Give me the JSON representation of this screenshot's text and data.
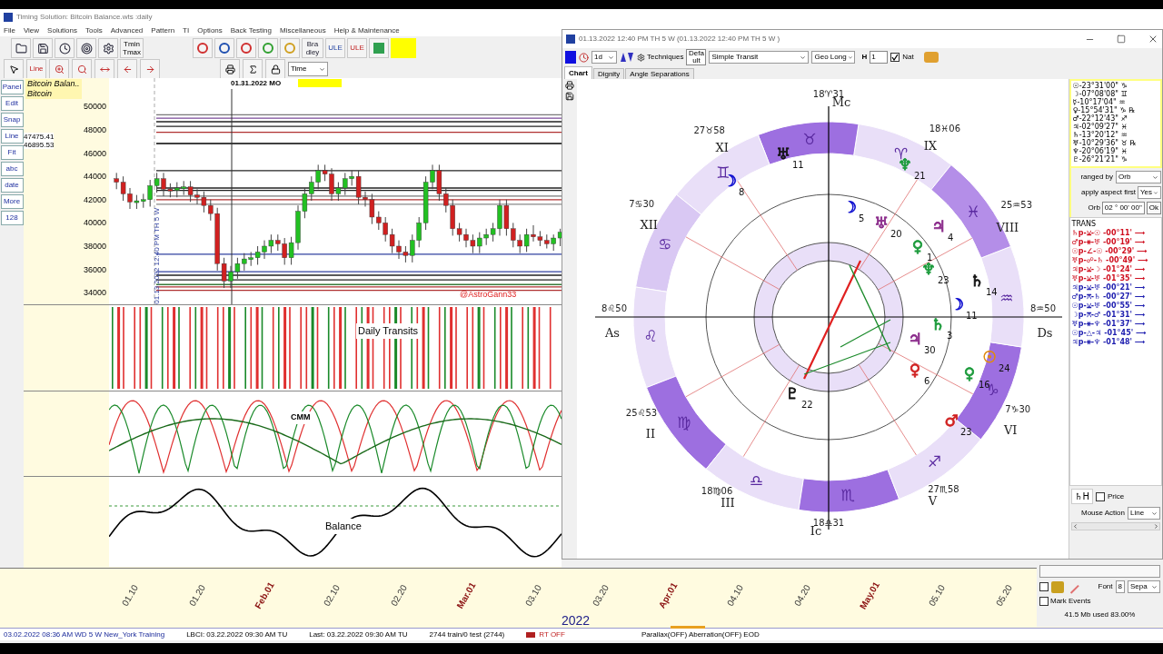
{
  "main_window": {
    "title": "Timing Solution: Bitcoin Balance.wts :daily"
  },
  "menu": [
    "File",
    "View",
    "Solutions",
    "Tools",
    "Advanced",
    "Pattern",
    "TI",
    "Options",
    "Back Testing",
    "Miscellaneous",
    "Help & Maintenance"
  ],
  "toolbar": {
    "tmin": "Tmin",
    "tmax": "Tmax",
    "bradley": "Bra dley",
    "ule": "ULE",
    "ule_framed": "ULE",
    "lines": "Line",
    "time_select": "Time"
  },
  "left_tools": [
    "Panel",
    "Edit",
    "Snap",
    "Line",
    "Fit",
    "abc",
    "date",
    "More",
    "128"
  ],
  "legend": {
    "title": "Bitcoin Balan..",
    "subtitle": "Bitcoin"
  },
  "price_markers": [
    "47475.41",
    "46895.53"
  ],
  "price_chart": {
    "chart_data": {
      "type": "candlestick",
      "ref_lines": [
        {
          "axis": "y",
          "value": 49300,
          "color": "#777777"
        },
        {
          "axis": "y",
          "value": 49000,
          "color": "#7a4a9a"
        },
        {
          "axis": "y",
          "value": 48700,
          "color": "#222222"
        },
        {
          "axis": "y",
          "value": 48300,
          "color": "#222222"
        },
        {
          "axis": "y",
          "value": 47800,
          "color": "#b03030"
        },
        {
          "axis": "y",
          "value": 46826,
          "color": "#000000"
        },
        {
          "axis": "y",
          "value": 44500,
          "color": "#222222"
        },
        {
          "axis": "y",
          "value": 43000,
          "color": "#222222"
        },
        {
          "axis": "y",
          "value": 42800,
          "color": "#222222"
        },
        {
          "axis": "y",
          "value": 42300,
          "color": "#777777"
        },
        {
          "axis": "y",
          "value": 42000,
          "color": "#b03030"
        },
        {
          "axis": "y",
          "value": 41600,
          "color": "#888888"
        },
        {
          "axis": "y",
          "value": 37300,
          "color": "#3040a0"
        },
        {
          "axis": "y",
          "value": 35800,
          "color": "#3040a0"
        },
        {
          "axis": "y",
          "value": 35500,
          "color": "#222222"
        },
        {
          "axis": "y",
          "value": 35100,
          "color": "#222222"
        },
        {
          "axis": "y",
          "value": 34700,
          "color": "#3a7a3a"
        },
        {
          "axis": "y",
          "value": 34500,
          "color": "#b03030"
        },
        {
          "axis": "y",
          "value": 34200,
          "color": "#b03030"
        }
      ],
      "ohlc": [
        [
          43800,
          44300,
          42900,
          43500
        ],
        [
          43500,
          44000,
          41900,
          42500
        ],
        [
          42500,
          43000,
          41200,
          41800
        ],
        [
          41800,
          42400,
          41200,
          41900
        ],
        [
          41900,
          42500,
          41300,
          42000
        ],
        [
          42000,
          43700,
          41400,
          43200
        ],
        [
          43200,
          44300,
          42600,
          43800
        ],
        [
          43800,
          44300,
          42300,
          42900
        ],
        [
          42900,
          43400,
          42200,
          42800
        ],
        [
          42800,
          43500,
          42200,
          43000
        ],
        [
          43000,
          43600,
          42400,
          43100
        ],
        [
          43100,
          43600,
          41800,
          42400
        ],
        [
          42400,
          42900,
          41600,
          42200
        ],
        [
          42200,
          42700,
          40900,
          41500
        ],
        [
          41500,
          42000,
          40200,
          40800
        ],
        [
          40800,
          41300,
          35900,
          36500
        ],
        [
          36500,
          37000,
          34400,
          35000
        ],
        [
          35000,
          36300,
          34400,
          35800
        ],
        [
          35800,
          37000,
          35200,
          36500
        ],
        [
          36500,
          37400,
          35900,
          36900
        ],
        [
          36900,
          37500,
          36300,
          37000
        ],
        [
          37000,
          38000,
          36400,
          37500
        ],
        [
          37500,
          38500,
          36900,
          38000
        ],
        [
          38000,
          39000,
          37400,
          38500
        ],
        [
          38500,
          39000,
          37600,
          38200
        ],
        [
          38200,
          38700,
          36400,
          37000
        ],
        [
          37000,
          38800,
          36400,
          38300
        ],
        [
          38300,
          41500,
          37700,
          41000
        ],
        [
          41000,
          43000,
          40400,
          42500
        ],
        [
          42500,
          44000,
          41900,
          43500
        ],
        [
          43500,
          45000,
          42900,
          44500
        ],
        [
          44500,
          45000,
          43600,
          44200
        ],
        [
          44200,
          44700,
          41900,
          42500
        ],
        [
          42500,
          43500,
          41900,
          43000
        ],
        [
          43000,
          44300,
          42400,
          43800
        ],
        [
          43800,
          44500,
          43200,
          44000
        ],
        [
          44000,
          44500,
          41600,
          42200
        ],
        [
          42200,
          42700,
          41400,
          42000
        ],
        [
          42000,
          42500,
          39900,
          40500
        ],
        [
          40500,
          41000,
          39400,
          40000
        ],
        [
          40000,
          40500,
          38400,
          39000
        ],
        [
          39000,
          39500,
          37400,
          38000
        ],
        [
          38000,
          38500,
          36900,
          37500
        ],
        [
          37500,
          38000,
          36600,
          37200
        ],
        [
          37200,
          39000,
          36600,
          38500
        ],
        [
          38500,
          40500,
          37900,
          40000
        ],
        [
          40000,
          44000,
          39400,
          43500
        ],
        [
          43500,
          45000,
          42900,
          44500
        ],
        [
          44500,
          45000,
          41900,
          42500
        ],
        [
          42500,
          43000,
          40900,
          41500
        ],
        [
          41500,
          42000,
          38900,
          39500
        ],
        [
          39500,
          40000,
          38400,
          39000
        ],
        [
          39000,
          39500,
          37900,
          38500
        ],
        [
          38500,
          39000,
          37400,
          38000
        ],
        [
          38000,
          39200,
          37400,
          38700
        ],
        [
          38700,
          39500,
          38100,
          39000
        ],
        [
          39000,
          40000,
          38400,
          39500
        ],
        [
          39500,
          42000,
          38900,
          41500
        ],
        [
          41500,
          42000,
          38900,
          39500
        ],
        [
          39500,
          40000,
          37900,
          38500
        ],
        [
          38500,
          39000,
          37400,
          38000
        ],
        [
          38000,
          39500,
          37500,
          39000
        ],
        [
          39000,
          39800,
          38400,
          38800
        ],
        [
          38800,
          39300,
          38000,
          38500
        ],
        [
          38500,
          39000,
          37800,
          38200
        ],
        [
          38200,
          39000,
          37600,
          38700
        ],
        [
          38700,
          39500,
          38000,
          39200
        ]
      ],
      "yticks": [
        34000,
        36000,
        38000,
        40000,
        42000,
        44000,
        46000,
        48000,
        50000
      ],
      "ylim": [
        33000,
        52450
      ]
    }
  },
  "date_axis": [
    {
      "label": "01.10",
      "kind": "day"
    },
    {
      "label": "01.20",
      "kind": "day"
    },
    {
      "label": "Feb.01",
      "kind": "month"
    },
    {
      "label": "02.10",
      "kind": "day"
    },
    {
      "label": "02.20",
      "kind": "day"
    },
    {
      "label": "Mar.01",
      "kind": "month"
    },
    {
      "label": "03.10",
      "kind": "day"
    },
    {
      "label": "03.20",
      "kind": "day"
    },
    {
      "label": "Apr.01",
      "kind": "month"
    },
    {
      "label": "04.10",
      "kind": "day"
    },
    {
      "label": "04.20",
      "kind": "day"
    },
    {
      "label": "May.01",
      "kind": "month"
    },
    {
      "label": "05.10",
      "kind": "day"
    },
    {
      "label": "05.20",
      "kind": "day"
    }
  ],
  "cursor_date": "01.31.2022 MO",
  "event_label": "01.13.2022 12:40 PM TH 5 W",
  "watermark_handle": "@AstroGann33",
  "panels": {
    "transits": "Daily Transits",
    "cmm": "CMM",
    "balance": "Balance"
  },
  "year": "2022",
  "status_bar": {
    "session": "03.02.2022 08:36 AM WD 5 W New_York Training",
    "lbci": "LBCI: 03.22.2022 09:30 AM TU",
    "last": "Last: 03.22.2022 09:30 AM TU",
    "train": "2744 train/0 test (2744)",
    "rt": "RT OFF",
    "mode": "Parallax(OFF) Aberration(OFF) EOD"
  },
  "chart_window": {
    "title": "01.13.2022 12:40 PM TH 5 W (01.13.2022 12:40 PM TH 5 W )",
    "interval": "1d",
    "techniques": "Techniques",
    "default": "Defa ult",
    "transit_select": "Simple Transit",
    "coordinate_select": "Geo Long",
    "harmonic_label": "H",
    "harmonic": "1",
    "nat": {
      "label": "Nat",
      "checked": true
    },
    "tabs": [
      {
        "label": "Chart",
        "selected": true
      },
      {
        "label": "Dignity",
        "selected": false
      },
      {
        "label": "Angle Separations",
        "selected": false
      }
    ]
  },
  "wheel": {
    "houses": [
      {
        "numeral": "Mc",
        "degree": "18♈31"
      },
      {
        "numeral": "XI",
        "degree": "27♉58"
      },
      {
        "numeral": "IX",
        "degree": "18♓06"
      },
      {
        "numeral": "XII",
        "degree": "7♋30"
      },
      {
        "numeral": "VIII",
        "degree": "25♒53"
      },
      {
        "numeral": "As",
        "degree": "8♌50"
      },
      {
        "numeral": "Ds",
        "degree": "8♒50"
      },
      {
        "numeral": "II",
        "degree": "25♌53"
      },
      {
        "numeral": "VI",
        "degree": "7♑30"
      },
      {
        "numeral": "III",
        "degree": "18♍06"
      },
      {
        "numeral": "V",
        "degree": "27♏58"
      },
      {
        "numeral": "Ic",
        "degree": "18♎31"
      }
    ],
    "signs": [
      {
        "glyph": "♈",
        "color": "#e9dff8"
      },
      {
        "glyph": "♉",
        "color": "#9d6fe0"
      },
      {
        "glyph": "♊",
        "color": "#e9dff8"
      },
      {
        "glyph": "♋",
        "color": "#d9c8f3"
      },
      {
        "glyph": "♌",
        "color": "#e9dff8"
      },
      {
        "glyph": "♍",
        "color": "#9d6fe0"
      },
      {
        "glyph": "♎",
        "color": "#e9dff8"
      },
      {
        "glyph": "♏",
        "color": "#9d6fe0"
      },
      {
        "glyph": "♐",
        "color": "#e9dff8"
      },
      {
        "glyph": "♑",
        "color": "#9d6fe0"
      },
      {
        "glyph": "♒",
        "color": "#e9dff8"
      },
      {
        "glyph": "♓",
        "color": "#b48ee8"
      }
    ],
    "planets": [
      {
        "glyph": "☽",
        "degree": "8",
        "color": "#1010d0"
      },
      {
        "glyph": "♅",
        "degree": "11",
        "color": "#111111"
      },
      {
        "glyph": "♆",
        "degree": "21",
        "color": "#1a9a3a"
      },
      {
        "glyph": "☽",
        "degree": "5",
        "color": "#1010d0"
      },
      {
        "glyph": "♅",
        "degree": "20",
        "color": "#8a2a8a"
      },
      {
        "glyph": "♃",
        "degree": "4",
        "color": "#8a2a8a"
      },
      {
        "glyph": "♀",
        "degree": "1",
        "color": "#1a9a3a"
      },
      {
        "glyph": "♆",
        "degree": "23",
        "color": "#1a9a3a"
      },
      {
        "glyph": "♄",
        "degree": "14",
        "color": "#111111"
      },
      {
        "glyph": "☽",
        "degree": "11",
        "color": "#1010d0"
      },
      {
        "glyph": "♄",
        "degree": "3",
        "color": "#1a9a3a"
      },
      {
        "glyph": "♃",
        "degree": "30",
        "color": "#8a2a8a"
      },
      {
        "glyph": "☉",
        "degree": "24",
        "color": "#e08a10"
      },
      {
        "glyph": "♀",
        "degree": "6",
        "color": "#d02020"
      },
      {
        "glyph": "♀",
        "degree": "16",
        "color": "#1a9a3a"
      },
      {
        "glyph": "♇",
        "degree": "22",
        "color": "#111111"
      },
      {
        "glyph": "♂",
        "degree": "23",
        "color": "#d02020"
      }
    ]
  },
  "side_panel": {
    "positions": [
      "☉-23°31'00\" ♑",
      "☽-07°08'08\" ♊",
      "☿-10°17'04\" ♒",
      "♀-15°54'31\" ♑ ℞",
      "♂-22°12'43\" ♐",
      "♃-02°09'27\" ♓",
      "♄-13°20'12\" ♒",
      "♅-10°29'36\" ♉ ℞",
      "♆-20°06'19\" ♓",
      "♇-26°21'21\" ♑"
    ],
    "ranged_by_label": "ranged by",
    "ranged_by": "Orb",
    "apply_label": "apply aspect first",
    "apply": "Yes",
    "orb_label": "Orb",
    "orb": "02 ° 00' 00\"",
    "ok": "Ok",
    "trans_title": "TRANS",
    "transits": [
      {
        "text": "♄p-⚺-☉ -00°11' ⟶",
        "color": "#d01020"
      },
      {
        "text": "♂p-⚹-♅ -00°19' ⟶",
        "color": "#d01020"
      },
      {
        "text": "☉p-∠-☉ -00°29' ⟶",
        "color": "#d01020"
      },
      {
        "text": "♅p-☍-♄ -00°49' ⟶",
        "color": "#d01020"
      },
      {
        "text": "♃p-⚺-☽ -01°24' ⟶",
        "color": "#d01020"
      },
      {
        "text": "♅p-⚺-♅ -01°35' ⟶",
        "color": "#d01020"
      },
      {
        "text": "♃p-⚺-♅ -00°21' ⟶",
        "color": "#2020b0"
      },
      {
        "text": "♂p-⚻-♄ -00°27' ⟶",
        "color": "#2020b0"
      },
      {
        "text": "☉p-⚺-♅ -00°55' ⟶",
        "color": "#2020b0"
      },
      {
        "text": "☽p-⚻-♂ -01°31' ⟶",
        "color": "#2020b0"
      },
      {
        "text": "♅p-⚹-♆ -01°37' ⟶",
        "color": "#2020b0"
      },
      {
        "text": "☉p-△-♃ -01°45' ⟶",
        "color": "#2020b0"
      },
      {
        "text": "♃p-⚹-♆ -01°48' ⟶",
        "color": "#2020b0"
      }
    ],
    "saturn_button": "♄H",
    "price": {
      "label": "Price",
      "checked": false
    },
    "mouse_action_label": "Mouse Action",
    "mouse_action": "Line"
  },
  "bottom_panel": {
    "toggle": {
      "checked": false
    },
    "mark_events": {
      "label": "Mark Events",
      "checked": false
    },
    "font_label": "Font",
    "font_size": "8",
    "separator": "Sepa",
    "memory": "41.5 Mb used 83.00%"
  }
}
